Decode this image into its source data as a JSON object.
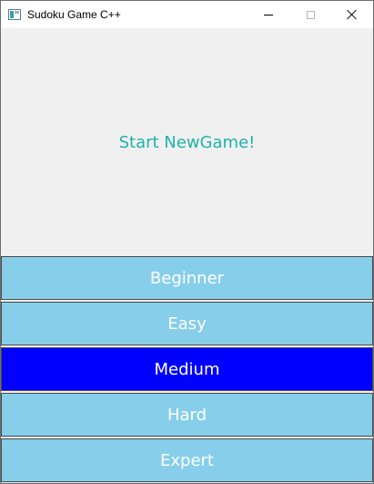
{
  "window": {
    "title": "Sudoku Game C++",
    "icon": "app-window-icon"
  },
  "hero": {
    "text": "Start NewGame!",
    "color": "#20b2aa"
  },
  "levels": [
    {
      "label": "Beginner",
      "selected": false
    },
    {
      "label": "Easy",
      "selected": false
    },
    {
      "label": "Medium",
      "selected": true
    },
    {
      "label": "Hard",
      "selected": false
    },
    {
      "label": "Expert",
      "selected": false
    }
  ],
  "colors": {
    "button_bg": "#87ceeb",
    "button_selected_bg": "#0000ff",
    "button_text": "#ffffff"
  }
}
